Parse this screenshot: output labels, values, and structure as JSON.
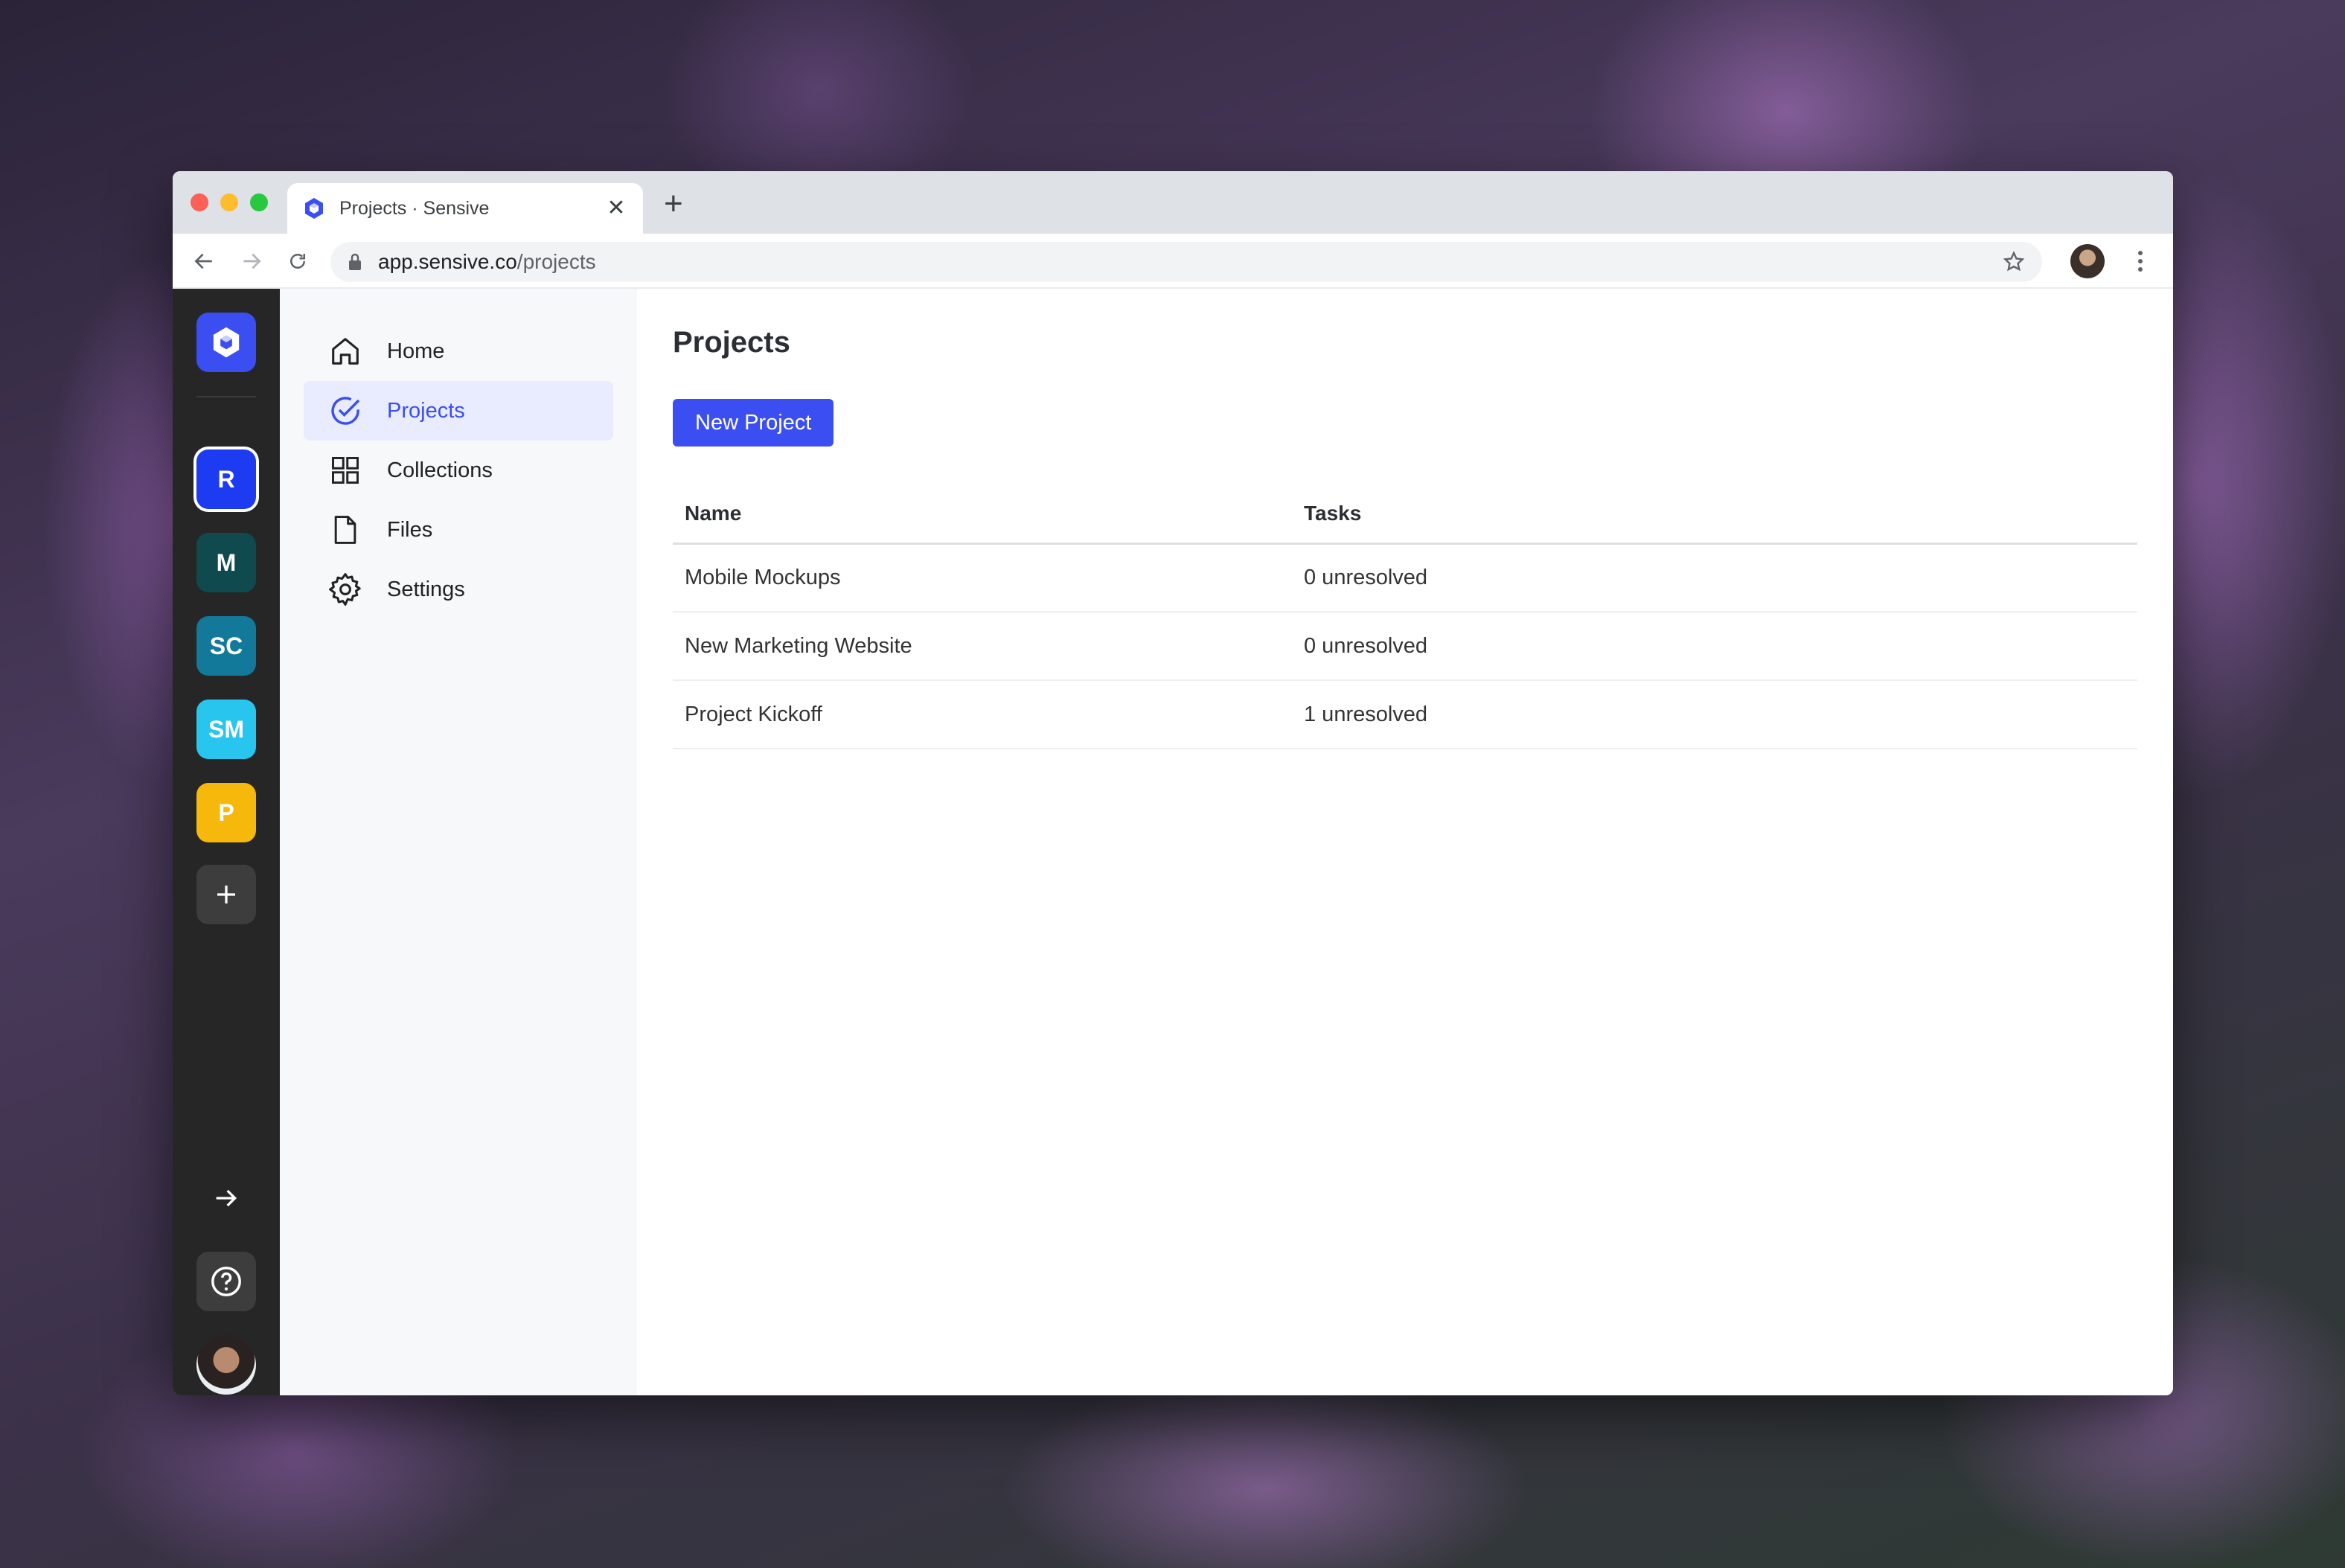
{
  "browser": {
    "tab_title": "Projects · Sensive",
    "url_host": "app.sensive.co",
    "url_path": "/projects"
  },
  "workspace_rail": {
    "workspaces": [
      {
        "initials": "R",
        "color": "#1d3bf0"
      },
      {
        "initials": "M",
        "color": "#0f4a4f"
      },
      {
        "initials": "SC",
        "color": "#12799a"
      },
      {
        "initials": "SM",
        "color": "#28c5ef"
      },
      {
        "initials": "P",
        "color": "#f7b80c"
      }
    ],
    "add_icon": "plus-icon",
    "collapse_icon": "arrow-right-icon",
    "help_icon": "question-circle-icon",
    "logo_color": "#3a4ef2"
  },
  "sidebar": {
    "items": [
      {
        "label": "Home",
        "icon": "home-icon"
      },
      {
        "label": "Projects",
        "icon": "check-circle-icon",
        "active": true
      },
      {
        "label": "Collections",
        "icon": "grid-icon"
      },
      {
        "label": "Files",
        "icon": "file-icon"
      },
      {
        "label": "Settings",
        "icon": "gear-icon"
      }
    ]
  },
  "main": {
    "title": "Projects",
    "new_button": "New Project",
    "table": {
      "headers": [
        "Name",
        "Tasks"
      ],
      "rows": [
        [
          "Mobile Mockups",
          "0 unresolved"
        ],
        [
          "New Marketing Website",
          "0 unresolved"
        ],
        [
          "Project Kickoff",
          "1 unresolved"
        ]
      ]
    }
  },
  "colors": {
    "accent": "#3a4ef2",
    "active_bg": "#e9ecff",
    "rail_bg": "#262626"
  }
}
